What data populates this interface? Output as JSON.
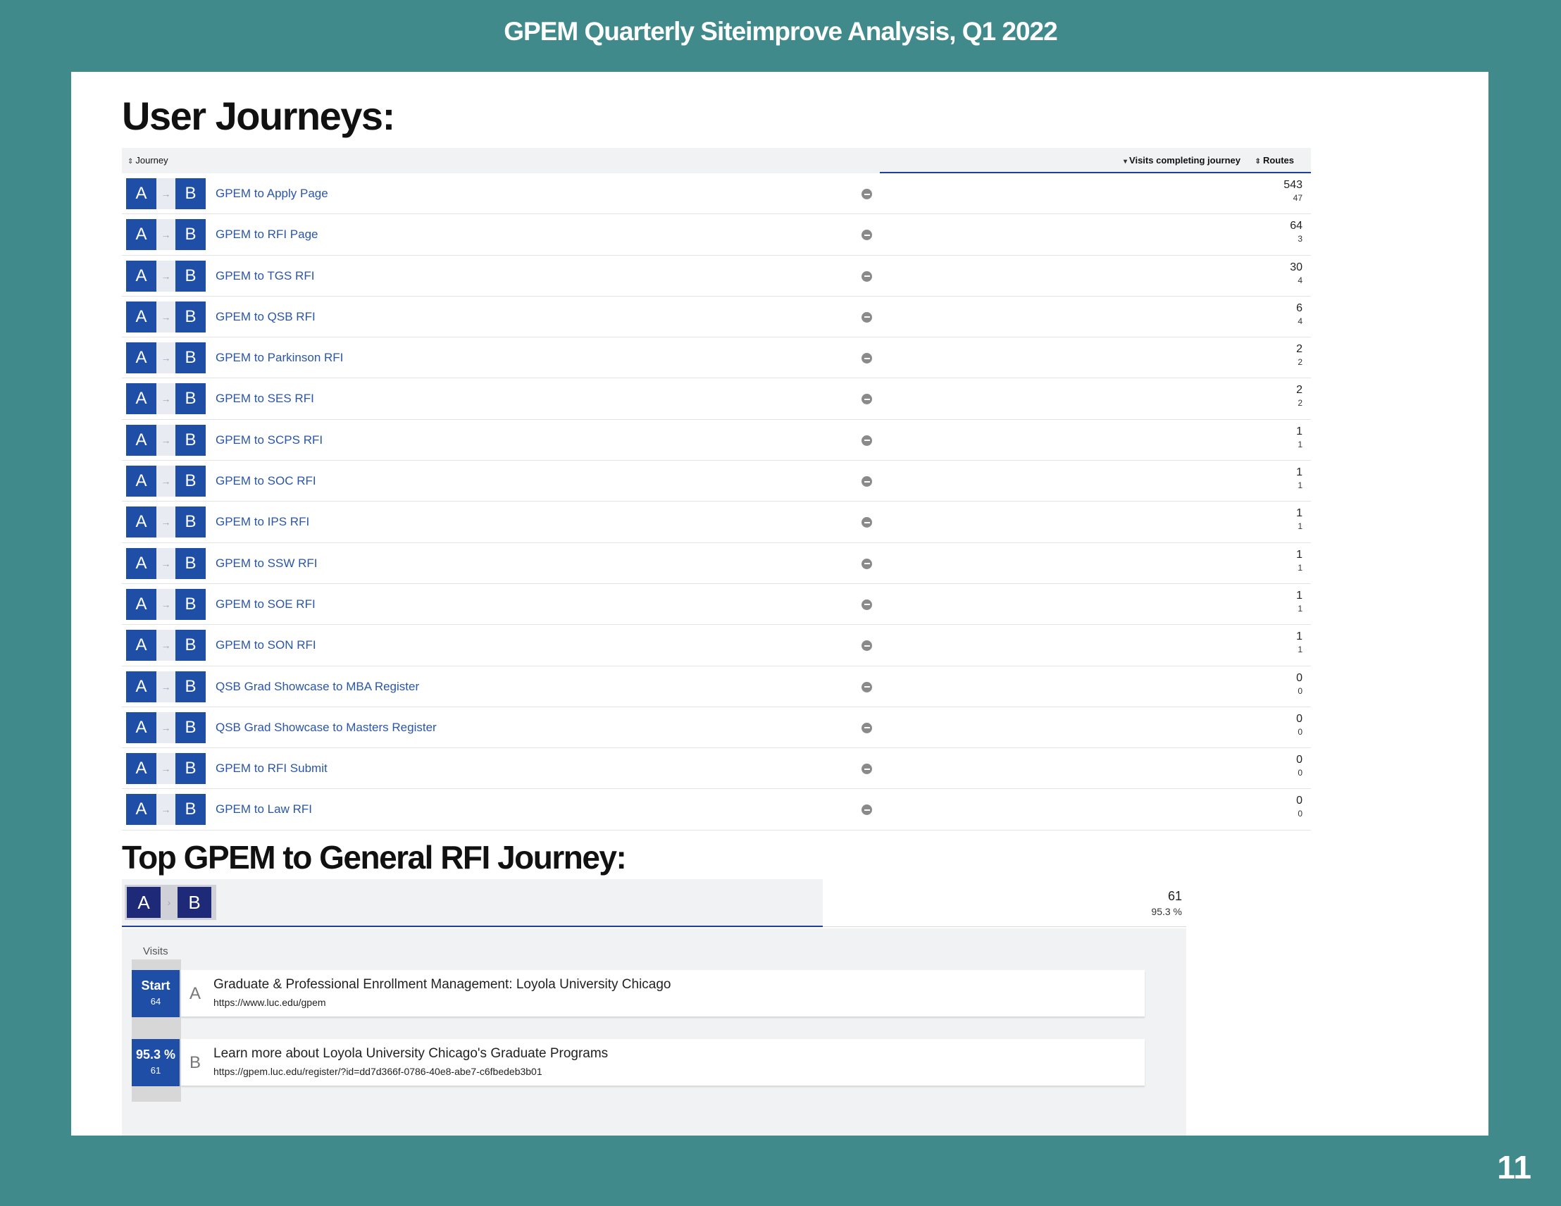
{
  "header": {
    "title": "GPEM Quarterly Siteimprove Analysis, Q1 2022"
  },
  "page_number": "11",
  "journeys": {
    "heading": "User Journeys:",
    "columns": {
      "journey": "Journey",
      "visits": "Visits completing journey",
      "routes": "Routes"
    },
    "badge": {
      "a": "A",
      "b": "B"
    },
    "rows": [
      {
        "name": "GPEM to Apply Page",
        "visits": "543",
        "routes": "47"
      },
      {
        "name": "GPEM to RFI Page",
        "visits": "64",
        "routes": "3"
      },
      {
        "name": "GPEM to TGS RFI",
        "visits": "30",
        "routes": "4"
      },
      {
        "name": "GPEM to QSB RFI",
        "visits": "6",
        "routes": "4"
      },
      {
        "name": "GPEM to Parkinson RFI",
        "visits": "2",
        "routes": "2"
      },
      {
        "name": "GPEM to SES RFI",
        "visits": "2",
        "routes": "2"
      },
      {
        "name": "GPEM to SCPS RFI",
        "visits": "1",
        "routes": "1"
      },
      {
        "name": "GPEM to SOC RFI",
        "visits": "1",
        "routes": "1"
      },
      {
        "name": "GPEM to IPS RFI",
        "visits": "1",
        "routes": "1"
      },
      {
        "name": "GPEM to SSW RFI",
        "visits": "1",
        "routes": "1"
      },
      {
        "name": "GPEM to SOE RFI",
        "visits": "1",
        "routes": "1"
      },
      {
        "name": "GPEM to SON RFI",
        "visits": "1",
        "routes": "1"
      },
      {
        "name": "QSB Grad Showcase to MBA Register",
        "visits": "0",
        "routes": "0"
      },
      {
        "name": "QSB Grad Showcase to Masters Register",
        "visits": "0",
        "routes": "0"
      },
      {
        "name": "GPEM to RFI Submit",
        "visits": "0",
        "routes": "0"
      },
      {
        "name": "GPEM to Law RFI",
        "visits": "0",
        "routes": "0"
      }
    ]
  },
  "top_journey": {
    "heading": "Top GPEM to General RFI Journey:",
    "badge": {
      "a": "A",
      "b": "B"
    },
    "visits": "61",
    "percent": "95.3 %",
    "visits_label": "Visits",
    "start": {
      "label": "Start",
      "count": "64"
    },
    "end": {
      "label": "95.3 %",
      "count": "61"
    },
    "step_a": {
      "letter": "A",
      "title": "Graduate & Professional Enrollment Management: Loyola University Chicago",
      "url": "https://www.luc.edu/gpem"
    },
    "step_b": {
      "letter": "B",
      "title": "Learn more about Loyola University Chicago's Graduate Programs",
      "url": "https://gpem.luc.edu/register/?id=dd7d366f-0786-40e8-abe7-c6fbedeb3b01"
    }
  }
}
